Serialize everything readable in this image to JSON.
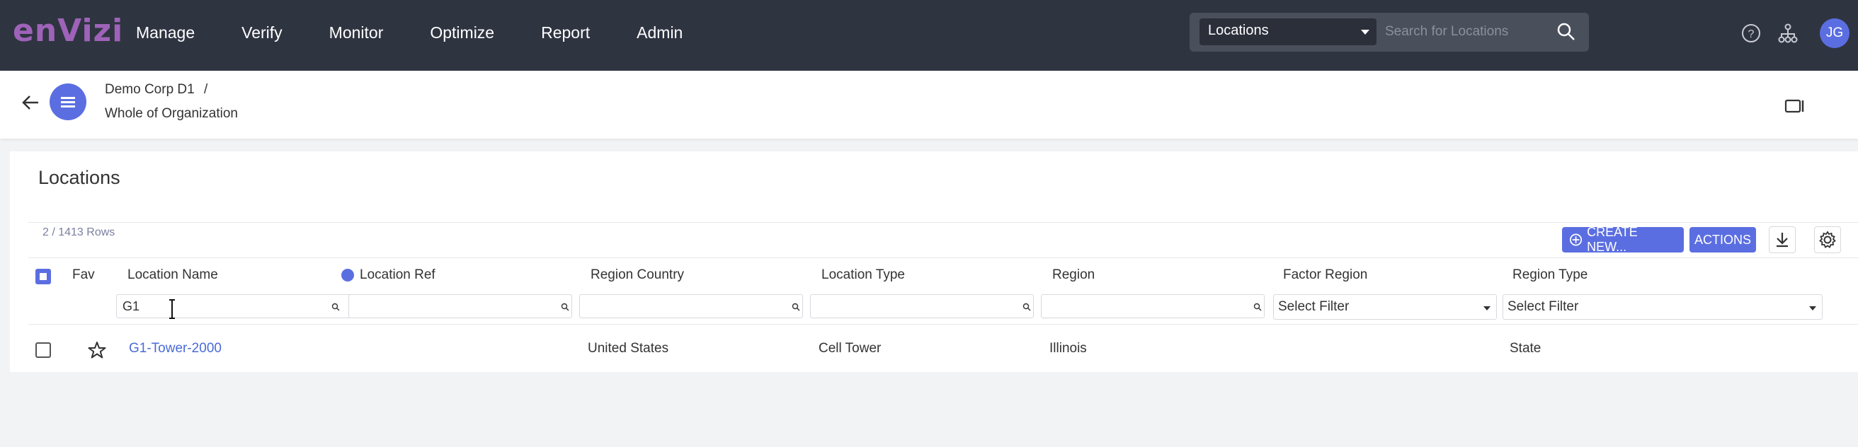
{
  "app": {
    "logo": "enVizi"
  },
  "nav": {
    "items": [
      "Manage",
      "Verify",
      "Monitor",
      "Optimize",
      "Report",
      "Admin"
    ]
  },
  "search": {
    "scope": "Locations",
    "placeholder": "Search for Locations"
  },
  "user": {
    "initials": "JG"
  },
  "breadcrumb": {
    "org": "Demo Corp D1",
    "separator": "/",
    "node": "Whole of Organization"
  },
  "page": {
    "title": "Locations",
    "row_count": "2 / 1413 Rows"
  },
  "toolbar": {
    "create_label": "CREATE NEW...",
    "actions_label": "ACTIONS"
  },
  "table": {
    "columns": [
      "Fav",
      "Location Name",
      "Location Ref",
      "Region Country",
      "Location Type",
      "Region",
      "Factor Region",
      "Region Type"
    ],
    "filters": {
      "location_name": "G1",
      "select_placeholder": "Select Filter"
    },
    "rows": [
      {
        "location_name": "G1-Tower-2000",
        "location_ref": "",
        "region_country": "United States",
        "location_type": "Cell Tower",
        "region": "Illinois",
        "factor_region": "",
        "region_type": "State"
      }
    ]
  },
  "colors": {
    "topbar": "#2f3441",
    "accent": "#5b6ee1",
    "logo": "#9e63b8",
    "link": "#4a6bd6"
  },
  "icons": [
    "search-icon",
    "help-icon",
    "hierarchy-icon",
    "back-arrow-icon",
    "menu-icon",
    "video-icon",
    "add-circle-icon",
    "download-icon",
    "gear-icon",
    "star-icon",
    "text-cursor-icon"
  ]
}
